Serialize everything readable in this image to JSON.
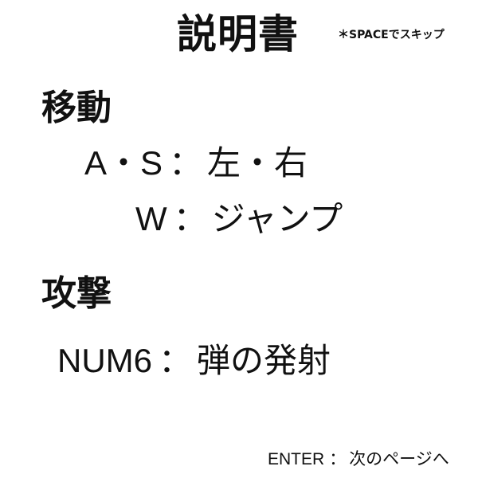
{
  "screen": {
    "title": "説明書",
    "skip_hint": "＊SPACEでスキップ",
    "sections": {
      "movement": {
        "heading": "移動",
        "controls": [
          {
            "key": "A・S",
            "separator": "：",
            "action": "左・右"
          },
          {
            "key": "W",
            "separator": "：",
            "action": "ジャンプ"
          }
        ]
      },
      "attack": {
        "heading": "攻撃",
        "controls": [
          {
            "key": "NUM6",
            "separator": "：",
            "action": "弾の発射"
          }
        ]
      }
    },
    "footer": {
      "key": "ENTER",
      "separator": "：",
      "action": "次のページへ"
    }
  }
}
